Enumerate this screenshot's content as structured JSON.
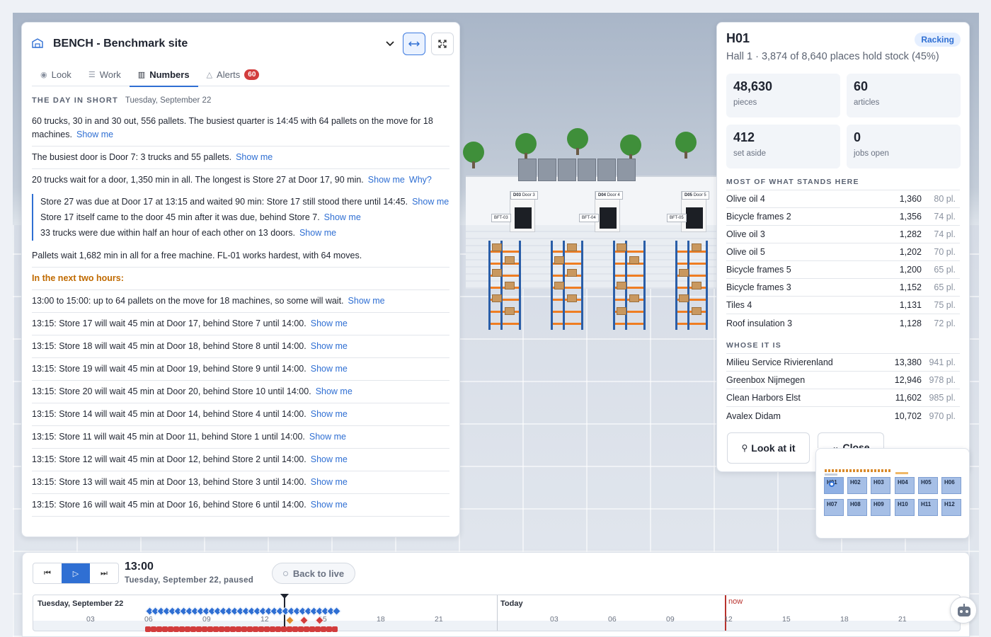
{
  "left_panel": {
    "site_name": "BENCH - Benchmark site",
    "tabs": [
      {
        "label": "Look",
        "icon": "eye-icon"
      },
      {
        "label": "Work",
        "icon": "list-icon"
      },
      {
        "label": "Numbers",
        "icon": "bar-chart-icon"
      },
      {
        "label": "Alerts",
        "icon": "warning-icon",
        "badge": "60"
      }
    ],
    "active_tab": "Numbers",
    "day_heading": "THE DAY IN SHORT",
    "day_date": "Tuesday, September 22",
    "summary": [
      {
        "text": "60 trucks, 30 in and 30 out, 556 pallets. The busiest quarter is 14:45 with 64 pallets on the move for 18 machines.",
        "link": "Show me"
      },
      {
        "text": "The busiest door is Door 7: 3 trucks and 55 pallets.",
        "link": "Show me"
      },
      {
        "text": "20 trucks wait for a door, 1,350 min in all. The longest is Store 27 at Door 17, 90 min.",
        "link": "Show me",
        "link2": "Why?"
      }
    ],
    "why_details": [
      {
        "text": "Store 27 was due at Door 17 at 13:15 and waited 90 min: Store 17 still stood there until 14:45.",
        "link": "Show me"
      },
      {
        "text": "Store 17 itself came to the door 45 min after it was due, behind Store 7.",
        "link": "Show me"
      },
      {
        "text": "33 trucks were due within half an hour of each other on 13 doors.",
        "link": "Show me"
      }
    ],
    "machines_line": "Pallets wait 1,682 min in all for a free machine. FL-01 works hardest, with 64 moves.",
    "next_heading": "In the next two hours:",
    "next_items": [
      {
        "text": "13:00 to 15:00: up to 64 pallets on the move for 18 machines, so some will wait.",
        "link": "Show me"
      },
      {
        "text": "13:15: Store 17 will wait 45 min at Door 17, behind Store 7 until 14:00.",
        "link": "Show me"
      },
      {
        "text": "13:15: Store 18 will wait 45 min at Door 18, behind Store 8 until 14:00.",
        "link": "Show me"
      },
      {
        "text": "13:15: Store 19 will wait 45 min at Door 19, behind Store 9 until 14:00.",
        "link": "Show me"
      },
      {
        "text": "13:15: Store 20 will wait 45 min at Door 20, behind Store 10 until 14:00.",
        "link": "Show me"
      },
      {
        "text": "13:15: Store 14 will wait 45 min at Door 14, behind Store 4 until 14:00.",
        "link": "Show me"
      },
      {
        "text": "13:15: Store 11 will wait 45 min at Door 11, behind Store 1 until 14:00.",
        "link": "Show me"
      },
      {
        "text": "13:15: Store 12 will wait 45 min at Door 12, behind Store 2 until 14:00.",
        "link": "Show me"
      },
      {
        "text": "13:15: Store 13 will wait 45 min at Door 13, behind Store 3 until 14:00.",
        "link": "Show me"
      },
      {
        "text": "13:15: Store 16 will wait 45 min at Door 16, behind Store 6 until 14:00.",
        "link": "Show me"
      }
    ]
  },
  "right_panel": {
    "title": "H01",
    "tag": "Racking",
    "subtitle": "Hall 1 · 3,874 of 8,640 places hold stock (45%)",
    "stats": [
      {
        "value": "48,630",
        "label": "pieces"
      },
      {
        "value": "60",
        "label": "articles"
      },
      {
        "value": "412",
        "label": "set aside"
      },
      {
        "value": "0",
        "label": "jobs open"
      }
    ],
    "most_heading": "MOST OF WHAT STANDS HERE",
    "most": [
      {
        "name": "Olive oil 4",
        "count": "1,360",
        "pl": "80 pl."
      },
      {
        "name": "Bicycle frames 2",
        "count": "1,356",
        "pl": "74 pl."
      },
      {
        "name": "Olive oil 3",
        "count": "1,282",
        "pl": "74 pl."
      },
      {
        "name": "Olive oil 5",
        "count": "1,202",
        "pl": "70 pl."
      },
      {
        "name": "Bicycle frames 5",
        "count": "1,200",
        "pl": "65 pl."
      },
      {
        "name": "Bicycle frames 3",
        "count": "1,152",
        "pl": "65 pl."
      },
      {
        "name": "Tiles 4",
        "count": "1,131",
        "pl": "75 pl."
      },
      {
        "name": "Roof insulation 3",
        "count": "1,128",
        "pl": "72 pl."
      }
    ],
    "whose_heading": "WHOSE IT IS",
    "whose": [
      {
        "name": "Milieu Service Rivierenland",
        "count": "13,380",
        "pl": "941 pl."
      },
      {
        "name": "Greenbox Nijmegen",
        "count": "12,946",
        "pl": "978 pl."
      },
      {
        "name": "Clean Harbors Elst",
        "count": "11,602",
        "pl": "985 pl."
      },
      {
        "name": "Avalex Didam",
        "count": "10,702",
        "pl": "970 pl."
      }
    ],
    "look_button": "Look at it",
    "close_button": "Close"
  },
  "minimap": {
    "halls": [
      "H01",
      "H02",
      "H03",
      "H04",
      "H05",
      "H06",
      "H07",
      "H08",
      "H09",
      "H10",
      "H11",
      "H12"
    ]
  },
  "scene": {
    "doors": [
      {
        "label": "D03",
        "sub": "Door 3"
      },
      {
        "label": "D04",
        "sub": "Door 4"
      },
      {
        "label": "D05",
        "sub": "Door 5"
      }
    ],
    "floor_tags": [
      "BFT-03",
      "BFT-04",
      "BFT-05"
    ]
  },
  "timeline": {
    "time": "13:00",
    "date_status": "Tuesday, September 22, paused",
    "back_to_live": "Back to live",
    "day1_label": "Tuesday, September 22",
    "day2_label": "Today",
    "now_label": "now",
    "ticks_day1": [
      "03",
      "06",
      "09",
      "12",
      "15",
      "18",
      "21"
    ],
    "ticks_day2": [
      "03",
      "06",
      "09",
      "12",
      "15",
      "18",
      "21"
    ]
  }
}
